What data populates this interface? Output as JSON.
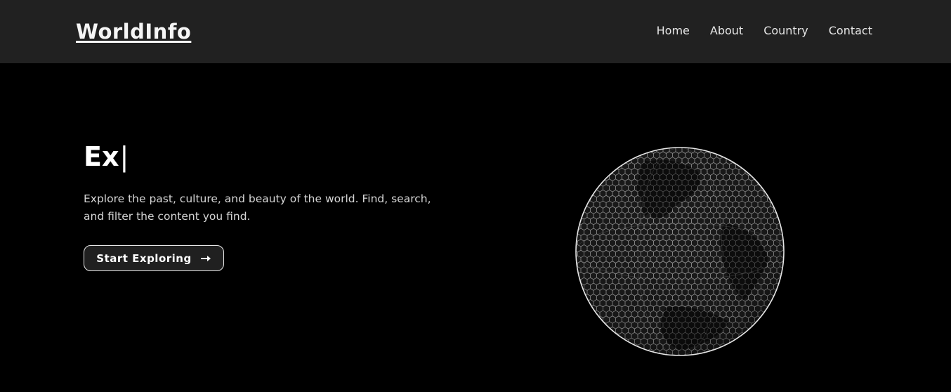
{
  "brand": {
    "name": "WorldInfo"
  },
  "nav": {
    "items": [
      {
        "label": "Home"
      },
      {
        "label": "About"
      },
      {
        "label": "Country"
      },
      {
        "label": "Contact"
      }
    ]
  },
  "hero": {
    "title": "Ex",
    "caret": "|",
    "description": "Explore the past, culture, and beauty of the world. Find, search, and filter the content you find.",
    "cta_label": "Start Exploring",
    "cta_icon": "arrow-right-icon"
  },
  "globe": {
    "icon": "hexagon-globe-icon"
  },
  "colors": {
    "page_background": "#000000",
    "navbar_background": "#212121",
    "text": "#ffffff",
    "button_background": "#202020"
  }
}
